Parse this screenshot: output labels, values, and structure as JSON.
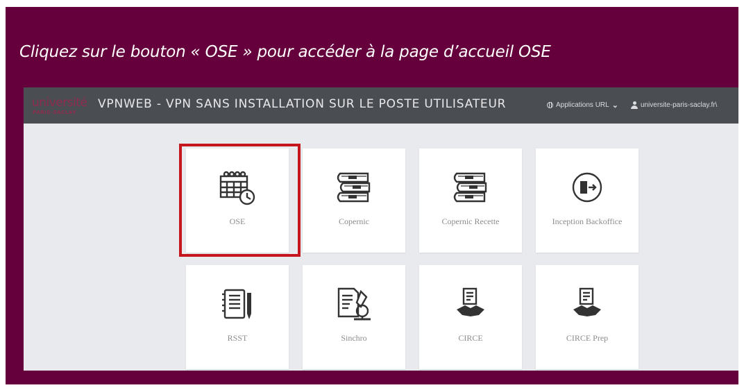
{
  "instruction": "Cliquez sur le bouton « OSE » pour accéder à la page d’accueil OSE",
  "highlight_color": "#c4161c",
  "header": {
    "logo_top": "université",
    "logo_bottom": "PARIS-SACLAY",
    "title": "VPNWEB - VPN SANS INSTALLATION SUR LE POSTE UTILISATEUR",
    "apps_menu": "Applications URL",
    "user": "universite-paris-saclay.fr\\"
  },
  "tiles": [
    {
      "label": "OSE",
      "icon": "calendar-clock-icon",
      "selected": true
    },
    {
      "label": "Copernic",
      "icon": "books-stack-icon"
    },
    {
      "label": "Copernic Recette",
      "icon": "books-stack-icon"
    },
    {
      "label": "Inception Backoffice",
      "icon": "sign-in-icon"
    },
    {
      "label": "RSST",
      "icon": "notebook-pencil-icon"
    },
    {
      "label": "Sinchro",
      "icon": "document-microscope-icon"
    },
    {
      "label": "CIRCE",
      "icon": "contract-handshake-icon"
    },
    {
      "label": "CIRCE Prep",
      "icon": "contract-handshake-icon"
    }
  ]
}
